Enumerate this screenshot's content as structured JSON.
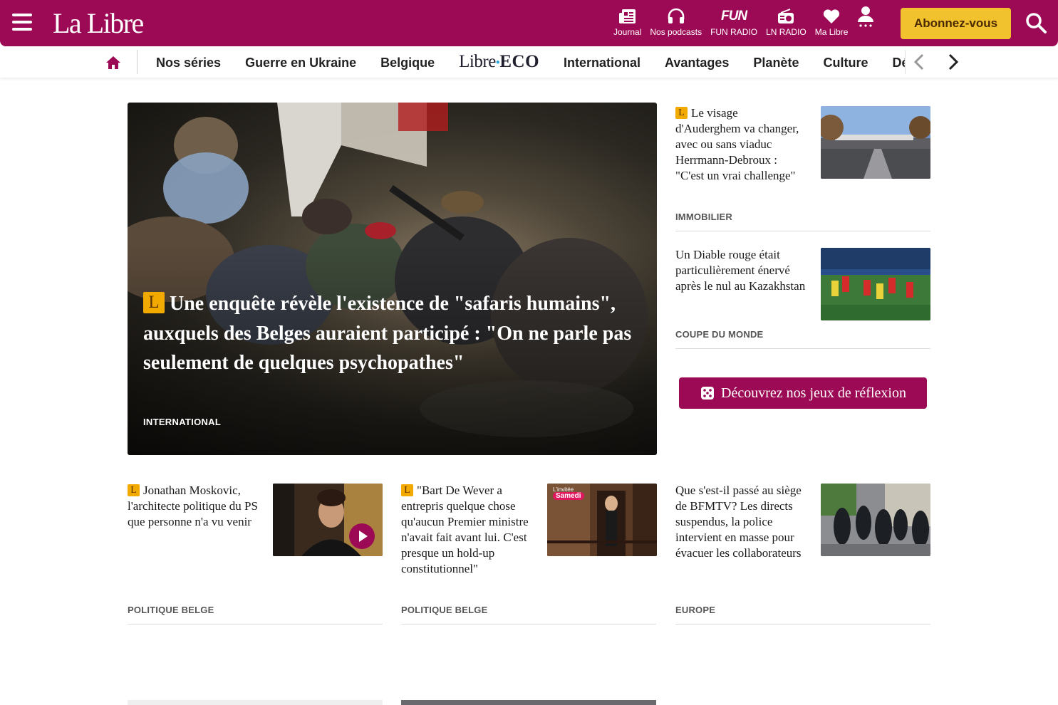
{
  "colors": {
    "brand": "#9c0a55",
    "accent": "#f2c12e",
    "premium_badge": "#f2a900"
  },
  "header": {
    "logo": "La Libre",
    "tools": [
      {
        "icon": "newspaper-icon",
        "label": "Journal"
      },
      {
        "icon": "headphones-icon",
        "label": "Nos podcasts"
      },
      {
        "icon": "fun-radio-logo",
        "label": "FUN RADIO",
        "logo_text": "FUN"
      },
      {
        "icon": "radio-icon",
        "label": "LN RADIO"
      },
      {
        "icon": "heart-icon",
        "label": "Ma Libre"
      },
      {
        "icon": "user-icon",
        "label": ""
      }
    ],
    "subscribe_label": "Abonnez-vous",
    "search_icon": "search-icon"
  },
  "nav": {
    "items": [
      "Nos séries",
      "Guerre en Ukraine",
      "Belgique",
      "International",
      "Avantages",
      "Planète",
      "Culture",
      "Débats"
    ],
    "libre_eco": {
      "part1": "Libre",
      "part2": "ECO"
    }
  },
  "hero": {
    "badge": "L",
    "title": "Une enquête révèle l'existence de \"safaris humains\", auxquels des Belges auraient participé : \"On ne parle pas seulement de quelques psychopathes\"",
    "category": "INTERNATIONAL"
  },
  "side_articles": [
    {
      "badge": "L",
      "title": "Le visage d'Auderghem va changer, avec ou sans viaduc Herrmann-Debroux : \"C'est un vrai challenge\"",
      "category": "IMMOBILIER"
    },
    {
      "badge": "",
      "title": "Un Diable rouge était particulièrement énervé après le nul au Kazakhstan",
      "category": "COUPE DU MONDE"
    }
  ],
  "games_button": "Découvrez nos jeux de réflexion",
  "articles": [
    {
      "badge": "L",
      "title": "Jonathan Moskovic, l'architecte politique du PS que personne n'a vu venir",
      "category": "POLITIQUE BELGE",
      "has_video": true
    },
    {
      "badge": "L",
      "title": "\"Bart De Wever a entrepris quelque chose qu'aucun Premier ministre n'avait fait avant lui. C'est presque un hold-up constitutionnel\"",
      "category": "POLITIQUE BELGE",
      "thumb_tag_1": "L'invitée",
      "thumb_tag_2": "Samedi"
    },
    {
      "badge": "",
      "title": "Que s'est-il passé au siège de BFMTV? Les directs suspendus, la police intervient en masse pour évacuer les collaborateurs",
      "category": "EUROPE"
    }
  ]
}
